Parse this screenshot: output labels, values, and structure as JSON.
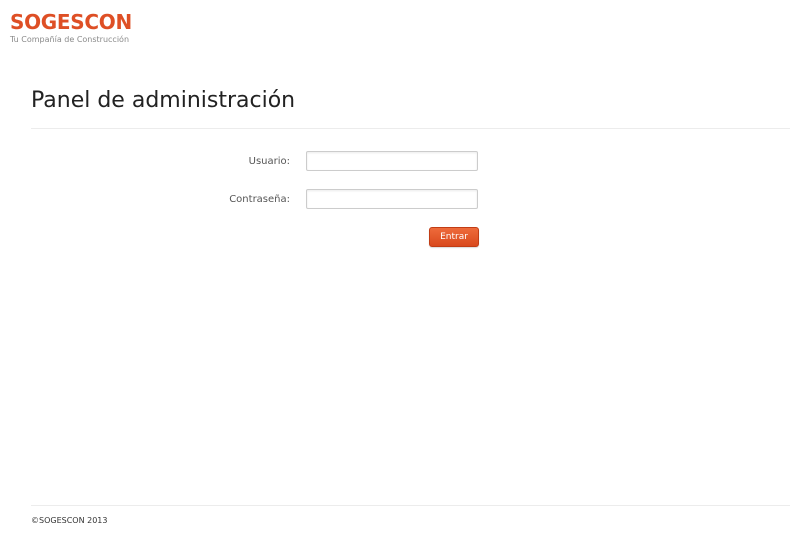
{
  "brand": {
    "name": "SOGESCON",
    "tagline": "Tu Compañía de Construcción"
  },
  "page": {
    "title": "Panel de administración"
  },
  "login_form": {
    "username_label": "Usuario:",
    "username_value": "",
    "password_label": "Contraseña:",
    "password_value": "",
    "submit_label": "Entrar"
  },
  "footer": {
    "copyright": "©SOGESCON 2013"
  },
  "colors": {
    "brand_accent": "#de4f25",
    "button_top": "#ee6b3b",
    "button_bottom": "#d9491d",
    "divider": "#ececec"
  }
}
